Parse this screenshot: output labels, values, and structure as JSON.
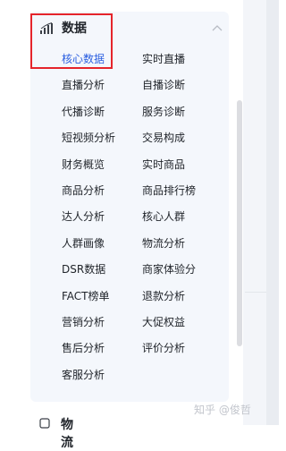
{
  "section": {
    "title": "数据",
    "icon": "bar-chart-icon",
    "toggle_icon": "chevron-up-icon",
    "accent_color": "#2b5fe0",
    "highlight_color": "#e5242b",
    "items": [
      {
        "label": "核心数据",
        "active": true
      },
      {
        "label": "实时直播",
        "active": false
      },
      {
        "label": "直播分析",
        "active": false
      },
      {
        "label": "自播诊断",
        "active": false
      },
      {
        "label": "代播诊断",
        "active": false
      },
      {
        "label": "服务诊断",
        "active": false
      },
      {
        "label": "短视频分析",
        "active": false
      },
      {
        "label": "交易构成",
        "active": false
      },
      {
        "label": "财务概览",
        "active": false
      },
      {
        "label": "实时商品",
        "active": false
      },
      {
        "label": "商品分析",
        "active": false
      },
      {
        "label": "商品排行榜",
        "active": false
      },
      {
        "label": "达人分析",
        "active": false
      },
      {
        "label": "核心人群",
        "active": false
      },
      {
        "label": "人群画像",
        "active": false
      },
      {
        "label": "物流分析",
        "active": false
      },
      {
        "label": "DSR数据",
        "active": false
      },
      {
        "label": "商家体验分",
        "active": false
      },
      {
        "label": "FACT榜单",
        "active": false
      },
      {
        "label": "退款分析",
        "active": false
      },
      {
        "label": "营销分析",
        "active": false
      },
      {
        "label": "大促权益",
        "active": false
      },
      {
        "label": "售后分析",
        "active": false
      },
      {
        "label": "评价分析",
        "active": false
      },
      {
        "label": "客服分析",
        "active": false
      }
    ]
  },
  "next_section": {
    "title": "物流",
    "icon": "next-section-icon"
  },
  "watermark": "知乎 @俊哲"
}
